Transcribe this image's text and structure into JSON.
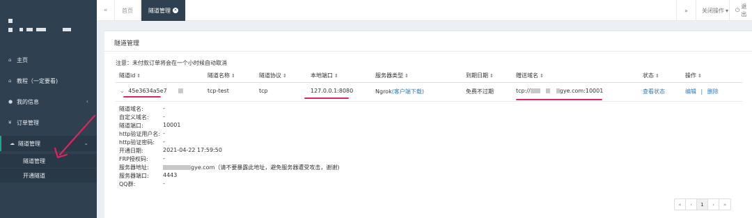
{
  "sidebar": {
    "items": [
      {
        "icon": "home-icon",
        "glyph": "⌂",
        "label": "主页"
      },
      {
        "icon": "home-icon",
        "glyph": "⌂",
        "label": "教程（一定要看)"
      },
      {
        "icon": "user-icon",
        "glyph": "●",
        "label": "我的信息"
      },
      {
        "icon": "yen-icon",
        "glyph": "¥",
        "label": "订单管理"
      },
      {
        "icon": "cloud-icon",
        "glyph": "☁",
        "label": "隧道管理"
      }
    ],
    "sub_items": [
      {
        "label": "隧道管理"
      },
      {
        "label": "开通隧道"
      }
    ]
  },
  "topbar": {
    "tab_home": "首页",
    "tab_active": "隧道管理",
    "close_ops": "关闭操作",
    "logout": "退出"
  },
  "panel": {
    "title": "隧道管理",
    "notice": "注意：未付款订单将会在一个小时候自动取消"
  },
  "table": {
    "headers": [
      "隧道id",
      "隧道名称",
      "隧道协议",
      "本地端口",
      "服务器类型",
      "到期日期",
      "赠送域名",
      "状态",
      "操作"
    ],
    "row": {
      "id": "45e3634a5e7",
      "name": "tcp-test",
      "protocol": "tcp",
      "local_port": "127.0.0.1:8080",
      "server_type": "Ngrok",
      "client_download": "(客户端下载)",
      "expiry": "免费不过期",
      "domain_prefix": "tcp://",
      "domain_suffix": "gye.com:10001",
      "status": "查看状态",
      "edit": "编辑",
      "sep": "|",
      "delete": "删除"
    }
  },
  "details": [
    {
      "label": "隧道域名:",
      "value": "-"
    },
    {
      "label": "自定义域名:",
      "value": "-"
    },
    {
      "label": "隧道端口:",
      "value": "10001"
    },
    {
      "label": "http验证用户名:",
      "value": "-"
    },
    {
      "label": "http验证密码:",
      "value": "-"
    },
    {
      "label": "开通日期:",
      "value": "2021-04-22 17:59:50"
    },
    {
      "label": "FRP授权码:",
      "value": "-"
    },
    {
      "label": "服务器地址:",
      "value": "gye.com（请不要暴露此地址，避免服务器遭受攻击，谢谢)"
    },
    {
      "label": "服务器端口:",
      "value": "4443"
    },
    {
      "label": "QQ群:",
      "value": "-"
    }
  ],
  "pager": [
    "«",
    "‹",
    "1",
    "›",
    "»"
  ],
  "colors": {
    "sidebar": "#2f4050",
    "accent": "#19aa8d",
    "link": "#337ab7",
    "highlight": "#e0245e"
  }
}
